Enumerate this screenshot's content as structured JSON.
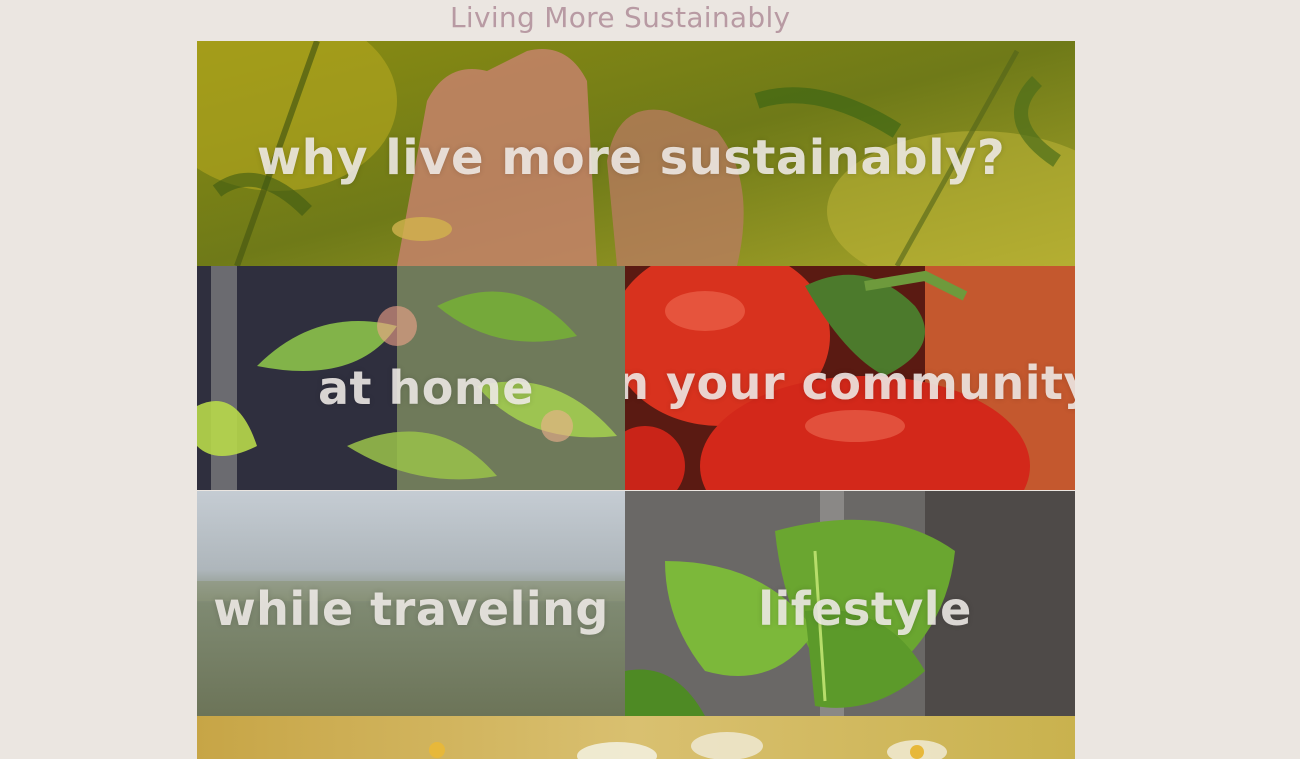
{
  "header": {
    "site_title": "Living More Sustainably"
  },
  "tiles": [
    {
      "label": "why live more sustainably?",
      "image": "hand-in-green-plants"
    },
    {
      "label": "at home",
      "image": "plant-by-window"
    },
    {
      "label": "in your community",
      "image": "tomatoes"
    },
    {
      "label": "while traveling",
      "image": "blurred-field"
    },
    {
      "label": "lifestyle",
      "image": "mint-leaves"
    },
    {
      "label": "",
      "image": "daisy-meadow"
    }
  ],
  "colors": {
    "page_background": "#ebe6e1",
    "title_color": "#b89aa3",
    "label_color": "#f0ece8"
  }
}
